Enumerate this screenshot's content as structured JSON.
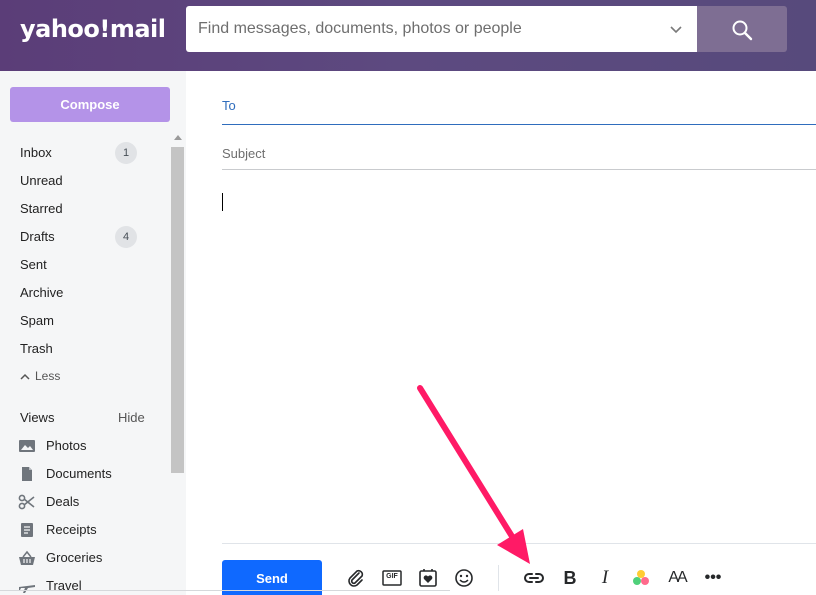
{
  "header": {
    "logo_text": "yahoo!mail",
    "search_placeholder": "Find messages, documents, photos or people"
  },
  "sidebar": {
    "compose_label": "Compose",
    "folders": [
      {
        "label": "Inbox",
        "badge": "1"
      },
      {
        "label": "Unread"
      },
      {
        "label": "Starred"
      },
      {
        "label": "Drafts",
        "badge": "4"
      },
      {
        "label": "Sent"
      },
      {
        "label": "Archive"
      },
      {
        "label": "Spam"
      },
      {
        "label": "Trash"
      }
    ],
    "less_label": "Less",
    "views_heading": "Views",
    "views_hide_label": "Hide",
    "views": [
      {
        "label": "Photos",
        "icon": "photo-icon"
      },
      {
        "label": "Documents",
        "icon": "document-icon"
      },
      {
        "label": "Deals",
        "icon": "scissors-icon"
      },
      {
        "label": "Receipts",
        "icon": "receipt-icon"
      },
      {
        "label": "Groceries",
        "icon": "basket-icon"
      },
      {
        "label": "Travel",
        "icon": "airplane-icon"
      }
    ]
  },
  "compose": {
    "to_label": "To",
    "subject_placeholder": "Subject",
    "send_label": "Send",
    "toolbar": {
      "gif_label": "GIF",
      "bold_glyph": "B",
      "italic_glyph": "I",
      "font_size_glyph": "AA",
      "more_glyph": "•••",
      "icons": [
        "attachment-icon",
        "gif-icon",
        "sticker-icon",
        "emoji-icon",
        "link-icon",
        "bold-icon",
        "italic-icon",
        "color-icon",
        "font-size-icon",
        "more-icon"
      ]
    }
  },
  "colors": {
    "header_bg": "#5b3d78",
    "compose_button": "#b493e8",
    "send_button": "#0f69ff",
    "to_underline": "#2f6dbd",
    "arrow": "#ff1a66"
  }
}
